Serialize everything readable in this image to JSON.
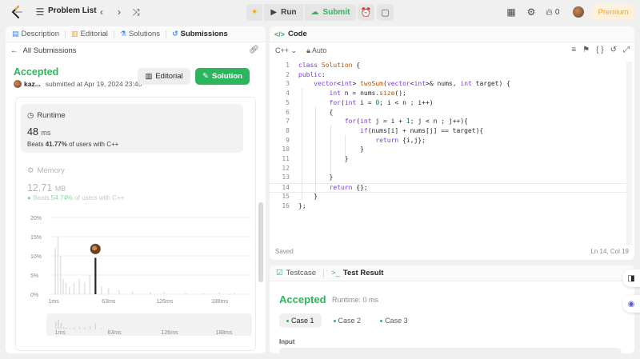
{
  "topbar": {
    "problem_list": "Problem List",
    "run": "Run",
    "submit": "Submit",
    "coins": "0",
    "premium": "Premium"
  },
  "left_tabs": [
    {
      "label": "Description"
    },
    {
      "label": "Editorial"
    },
    {
      "label": "Solutions"
    },
    {
      "label": "Submissions"
    }
  ],
  "submission": {
    "back_label": "All Submissions",
    "status": "Accepted",
    "user": "kaz...",
    "submitted_at": "submitted at Apr 19, 2024 23:45",
    "editorial_btn": "Editorial",
    "solution_btn": "Solution"
  },
  "runtime": {
    "title": "Runtime",
    "value": "48",
    "unit": "ms",
    "beats_prefix": "Beats",
    "beats_value": "41.77%",
    "beats_suffix": "of users with C++"
  },
  "memory": {
    "title": "Memory",
    "value": "12.71",
    "unit": "MB",
    "beats_prefix": "Beats",
    "beats_value": "54.74%",
    "beats_suffix": "of users with C++"
  },
  "chart_data": {
    "type": "bar",
    "y_ticks": [
      "20%",
      "15%",
      "10%",
      "5%",
      "0%"
    ],
    "ylim": [
      0,
      20
    ],
    "x_ticks": [
      "1ms",
      "63ms",
      "126ms",
      "188ms"
    ],
    "highlight_x": "48ms",
    "bars": [
      {
        "x": 3,
        "v": 12
      },
      {
        "x": 6,
        "v": 15
      },
      {
        "x": 9,
        "v": 10
      },
      {
        "x": 12,
        "v": 4
      },
      {
        "x": 15,
        "v": 3
      },
      {
        "x": 19,
        "v": 2
      },
      {
        "x": 24,
        "v": 3
      },
      {
        "x": 30,
        "v": 4
      },
      {
        "x": 36,
        "v": 3
      },
      {
        "x": 42,
        "v": 5
      },
      {
        "x": 48,
        "v": 9.5
      },
      {
        "x": 55,
        "v": 2
      },
      {
        "x": 63,
        "v": 1.5
      },
      {
        "x": 75,
        "v": 1
      },
      {
        "x": 90,
        "v": 0.8
      },
      {
        "x": 110,
        "v": 0.5
      },
      {
        "x": 126,
        "v": 0.6
      },
      {
        "x": 150,
        "v": 0.4
      },
      {
        "x": 170,
        "v": 0.3
      },
      {
        "x": 188,
        "v": 0.5
      },
      {
        "x": 205,
        "v": 0.3
      }
    ]
  },
  "editor": {
    "tab": "Code",
    "language": "C++",
    "mode": "Auto",
    "lines": [
      "class Solution {",
      "public:",
      "    vector<int> twoSum(vector<int>& nums, int target) {",
      "        int n = nums.size();",
      "        for(int i = 0; i < n ; i++)",
      "        {",
      "            for(int j = i + 1; j < n ; j++){",
      "                if(nums[i] + nums[j] == target){",
      "                    return {i,j};",
      "                }",
      "            }",
      "",
      "        }",
      "        return {};",
      "    }",
      "};"
    ],
    "status": "Saved",
    "cursor": "Ln 14, Col 19"
  },
  "result": {
    "tab_testcase": "Testcase",
    "tab_result": "Test Result",
    "status": "Accepted",
    "runtime": "Runtime: 0 ms",
    "cases": [
      "Case 1",
      "Case 2",
      "Case 3"
    ],
    "input_label": "Input"
  },
  "colors": {
    "accent_green": "#2db55d",
    "premium_orange": "#ffa116"
  }
}
